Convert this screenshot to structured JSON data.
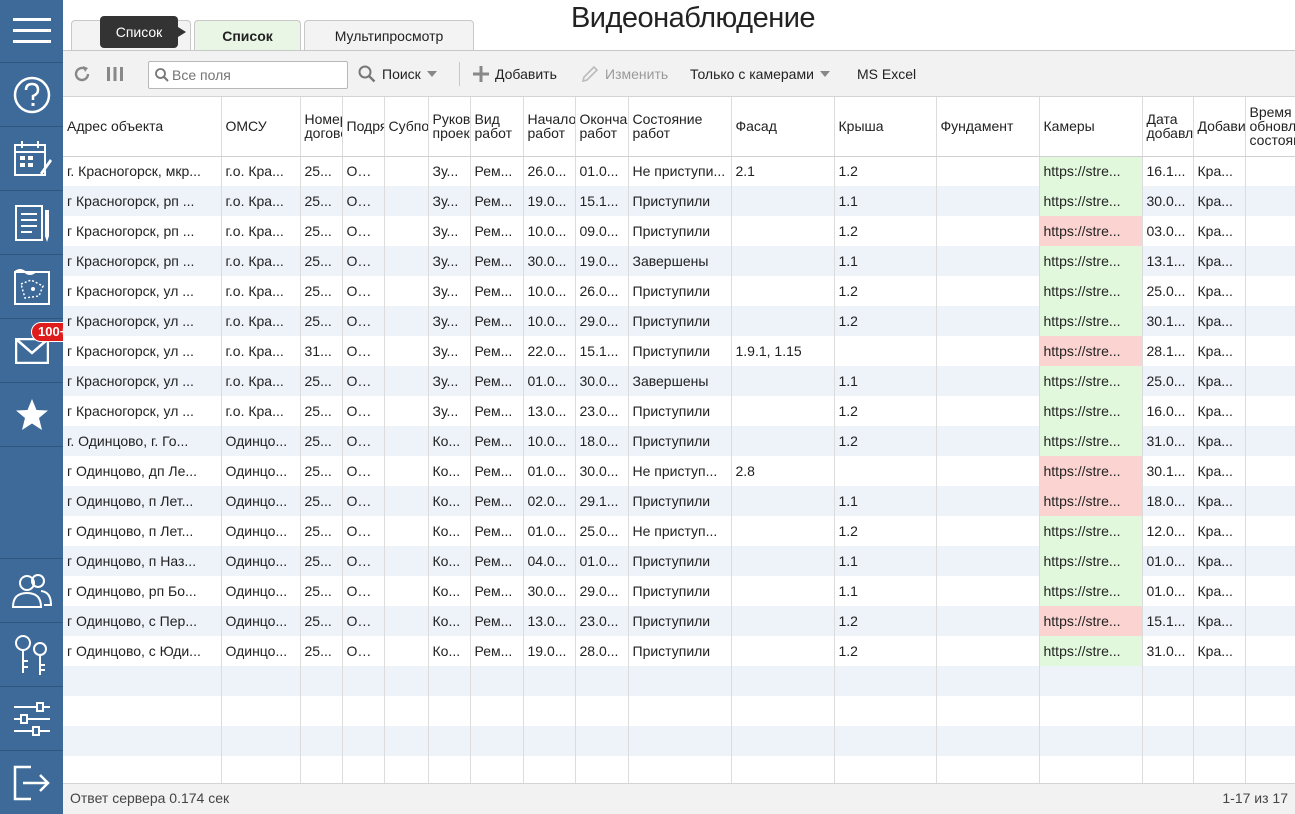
{
  "page_title": "Видеонаблюдение",
  "tooltip": "Список",
  "notification_badge": "100+",
  "tabs": [
    {
      "label": "Список",
      "partial": "О"
    },
    {
      "label": "Список"
    },
    {
      "label": "Мультипросмотр"
    }
  ],
  "toolbar": {
    "search_placeholder": "Все поля",
    "search_label": "Поиск",
    "add_label": "Добавить",
    "edit_label": "Изменить",
    "filter_label": "Только с камерами",
    "excel_label": "MS Excel"
  },
  "columns": [
    "Адрес объекта",
    "ОМСУ",
    "Номер договора",
    "Подрядчик",
    "Субподрядчик",
    "Руководитель проекта",
    "Вид работ",
    "Начало работ",
    "Окончание работ",
    "Состояние работ",
    "Фасад",
    "Крыша",
    "Фундамент",
    "Камеры",
    "Дата добавления",
    "Добавил",
    "Время обновления состояния"
  ],
  "rows": [
    [
      "г. Красногорск, мкр...",
      "г.о. Кра...",
      "25...",
      "ОО...",
      "",
      "Зу...",
      "Рем...",
      "26.0...",
      "01.0...",
      "Не приступи...",
      "2.1",
      "1.2",
      "",
      "https://stre...",
      "16.1...",
      "Кра...",
      "",
      "ok"
    ],
    [
      "г Красногорск, рп ...",
      "г.о. Кра...",
      "25...",
      "ОО...",
      "",
      "Зу...",
      "Рем...",
      "19.0...",
      "15.1...",
      "Приступили",
      "",
      "1.1",
      "",
      "https://stre...",
      "30.0...",
      "Кра...",
      "",
      "ok"
    ],
    [
      "г Красногорск, рп ...",
      "г.о. Кра...",
      "25...",
      "ОО...",
      "",
      "Зу...",
      "Рем...",
      "10.0...",
      "09.0...",
      "Приступили",
      "",
      "1.2",
      "",
      "https://stre...",
      "03.0...",
      "Кра...",
      "",
      "bad"
    ],
    [
      "г Красногорск, рп ...",
      "г.о. Кра...",
      "25...",
      "ОО...",
      "",
      "Зу...",
      "Рем...",
      "30.0...",
      "19.0...",
      "Завершены",
      "",
      "1.1",
      "",
      "https://stre...",
      "13.1...",
      "Кра...",
      "",
      "ok"
    ],
    [
      "г Красногорск, ул ...",
      "г.о. Кра...",
      "25...",
      "ОО...",
      "",
      "Зу...",
      "Рем...",
      "10.0...",
      "26.0...",
      "Приступили",
      "",
      "1.2",
      "",
      "https://stre...",
      "25.0...",
      "Кра...",
      "",
      "ok"
    ],
    [
      "г Красногорск, ул ...",
      "г.о. Кра...",
      "25...",
      "ОО...",
      "",
      "Зу...",
      "Рем...",
      "10.0...",
      "29.0...",
      "Приступили",
      "",
      "1.2",
      "",
      "https://stre...",
      "30.1...",
      "Кра...",
      "",
      "ok"
    ],
    [
      "г Красногорск, ул ...",
      "г.о. Кра...",
      "31...",
      "ОО...",
      "",
      "Зу...",
      "Рем...",
      "22.0...",
      "15.1...",
      "Приступили",
      "1.9.1, 1.15",
      "",
      "",
      "https://stre...",
      "28.1...",
      "Кра...",
      "",
      "bad"
    ],
    [
      "г Красногорск, ул ...",
      "г.о. Кра...",
      "25...",
      "ОО...",
      "",
      "Зу...",
      "Рем...",
      "01.0...",
      "30.0...",
      "Завершены",
      "",
      "1.1",
      "",
      "https://stre...",
      "25.0...",
      "Кра...",
      "",
      "ok"
    ],
    [
      "г Красногорск, ул ...",
      "г.о. Кра...",
      "25...",
      "ОО...",
      "",
      "Зу...",
      "Рем...",
      "13.0...",
      "23.0...",
      "Приступили",
      "",
      "1.2",
      "",
      "https://stre...",
      "16.0...",
      "Кра...",
      "",
      "ok"
    ],
    [
      "г. Одинцово, г. Го...",
      "Одинцо...",
      "25...",
      "ОО...",
      "",
      "Ко...",
      "Рем...",
      "10.0...",
      "18.0...",
      "Приступили",
      "",
      "1.2",
      "",
      "https://stre...",
      "31.0...",
      "Кра...",
      "",
      "ok"
    ],
    [
      "г Одинцово, дп Ле...",
      "Одинцо...",
      "25...",
      "ОО...",
      "",
      "Ко...",
      "Рем...",
      "01.0...",
      "30.0...",
      "Не приступ...",
      "2.8",
      "",
      "",
      "https://stre...",
      "30.1...",
      "Кра...",
      "",
      "bad"
    ],
    [
      "г Одинцово, п Лет...",
      "Одинцо...",
      "25...",
      "ОО...",
      "",
      "Ко...",
      "Рем...",
      "02.0...",
      "29.1...",
      "Приступили",
      "",
      "1.1",
      "",
      "https://stre...",
      "18.0...",
      "Кра...",
      "",
      "bad"
    ],
    [
      "г Одинцово, п Лет...",
      "Одинцо...",
      "25...",
      "ОО...",
      "",
      "Ко...",
      "Рем...",
      "01.0...",
      "25.0...",
      "Не приступ...",
      "",
      "1.2",
      "",
      "https://stre...",
      "12.0...",
      "Кра...",
      "",
      "ok"
    ],
    [
      "г Одинцово, п Наз...",
      "Одинцо...",
      "25...",
      "ОО...",
      "",
      "Ко...",
      "Рем...",
      "04.0...",
      "01.0...",
      "Приступили",
      "",
      "1.1",
      "",
      "https://stre...",
      "01.0...",
      "Кра...",
      "",
      "ok"
    ],
    [
      "г Одинцово, рп Бо...",
      "Одинцо...",
      "25...",
      "ОО...",
      "",
      "Ко...",
      "Рем...",
      "30.0...",
      "29.0...",
      "Приступили",
      "",
      "1.1",
      "",
      "https://stre...",
      "01.0...",
      "Кра...",
      "",
      "ok"
    ],
    [
      "г Одинцово, с Пер...",
      "Одинцо...",
      "25...",
      "ОО...",
      "",
      "Ко...",
      "Рем...",
      "13.0...",
      "23.0...",
      "Приступили",
      "",
      "1.2",
      "",
      "https://stre...",
      "15.1...",
      "Кра...",
      "",
      "bad"
    ],
    [
      "г Одинцово, с Юди...",
      "Одинцо...",
      "25...",
      "ОО...",
      "",
      "Ко...",
      "Рем...",
      "19.0...",
      "28.0...",
      "Приступили",
      "",
      "1.2",
      "",
      "https://stre...",
      "31.0...",
      "Кра...",
      "",
      "ok"
    ]
  ],
  "status": {
    "server_response": "Ответ сервера 0.174 сек",
    "pager": "1-17 из 17"
  },
  "colors": {
    "sidebar": "#3d6a99",
    "camera_ok": "#e1f8dc",
    "camera_bad": "#fbd3d1",
    "badge": "#e01b1b"
  },
  "sidebar_icons": [
    "menu-icon",
    "help-icon",
    "calendar-icon",
    "document-icon",
    "map-icon",
    "mail-icon",
    "star-icon",
    "users-icon",
    "keys-icon",
    "settings-icon",
    "logout-icon"
  ]
}
